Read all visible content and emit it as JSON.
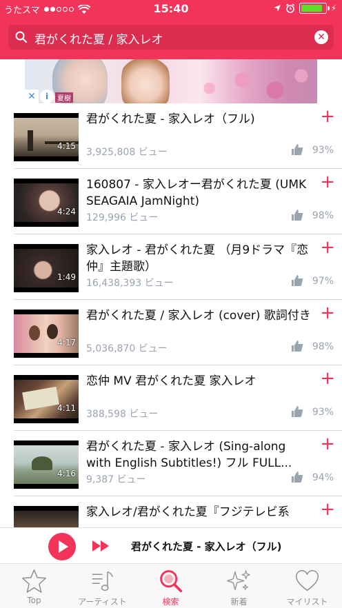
{
  "status": {
    "carrier": "うたスマ",
    "time": "15:40",
    "signal_dots_filled": 2,
    "signal_dots_total": 5,
    "battery_level": 0.9
  },
  "search": {
    "query": "君がくれた夏 / 家入レオ",
    "search_icon": "search-icon",
    "clear_icon": "clear-icon"
  },
  "ad": {
    "close_label": "✕",
    "info_label": "i",
    "caption": "夏樹"
  },
  "results": [
    {
      "title": "君がくれた夏 - 家入レオ（フル)",
      "views": "3,925,808 ビュー",
      "rating": "93%",
      "duration": "4:15"
    },
    {
      "title": "160807 - 家入レオー君がくれた夏 (UMK SEAGAIA JamNight)",
      "views": "129,996 ビュー",
      "rating": "98%",
      "duration": "4:24"
    },
    {
      "title": "家入レオ -  君がくれた夏 （月9ドラマ『恋仲』主題歌）",
      "views": "16,438,393 ビュー",
      "rating": "97%",
      "duration": "1:49"
    },
    {
      "title": "君がくれた夏 / 家入レオ (cover) 歌詞付き",
      "views": "5,036,870 ビュー",
      "rating": "98%",
      "duration": "4:17"
    },
    {
      "title": "恋仲 MV 君がくれた夏 家入レオ",
      "views": "388,598 ビュー",
      "rating": "93%",
      "duration": "4:11"
    },
    {
      "title": "君がくれた夏 - 家入レオ (Sing-along with English Subtitles!) フル FULL...",
      "views": "9,387 ビュー",
      "rating": "94%",
      "duration": "4:16"
    },
    {
      "title": "家入レオ/君がくれた夏『フジテレビ系",
      "views": "",
      "rating": "",
      "duration": ""
    }
  ],
  "add_label": "+",
  "player": {
    "now_playing": "君がくれた夏 - 家入レオ（フル)"
  },
  "tabs": [
    {
      "label": "Top",
      "icon": "star-icon",
      "active": false
    },
    {
      "label": "アーティスト",
      "icon": "music-list-icon",
      "active": false
    },
    {
      "label": "検索",
      "icon": "search-icon",
      "active": true
    },
    {
      "label": "新着",
      "icon": "sparkle-icon",
      "active": false
    },
    {
      "label": "マイリスト",
      "icon": "heart-icon",
      "active": false
    }
  ],
  "colors": {
    "accent": "#f2345a",
    "secondary_text": "#9aa3b0",
    "tab_inactive": "#8e8e93"
  }
}
